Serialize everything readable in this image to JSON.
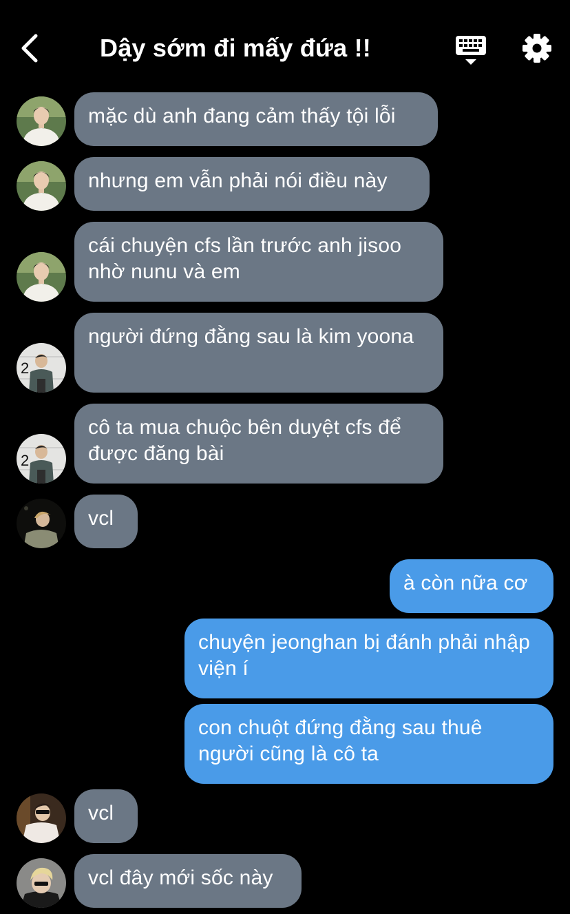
{
  "header": {
    "title": "Dậy sớm đi mấy đứa !!",
    "back_icon": "chevron-left-icon",
    "keyboard_icon": "keyboard-icon",
    "settings_icon": "gear-icon"
  },
  "colors": {
    "incoming_bubble": "#6b7785",
    "outgoing_bubble": "#4a9be8",
    "background": "#000000"
  },
  "messages": [
    {
      "direction": "incoming",
      "avatar": "avatar-white-shirt",
      "text": "mặc dù anh đang cảm thấy tội lỗi"
    },
    {
      "direction": "incoming",
      "avatar": "avatar-white-shirt",
      "text": "nhưng em vẫn phải nói điều này"
    },
    {
      "direction": "incoming",
      "avatar": "avatar-white-shirt",
      "text": "cái chuyện cfs lần trước anh jisoo nhờ nunu và em"
    },
    {
      "direction": "incoming",
      "avatar": "avatar-mugshot",
      "text": "người đứng đằng sau là kim yoona"
    },
    {
      "direction": "incoming",
      "avatar": "avatar-mugshot",
      "text": "cô ta mua chuộc bên duyệt cfs để được đăng bài"
    },
    {
      "direction": "incoming",
      "avatar": "avatar-green-shirt",
      "text": "vcl"
    },
    {
      "direction": "outgoing",
      "text": "à còn nữa cơ"
    },
    {
      "direction": "outgoing",
      "text": "chuyện jeonghan bị đánh phải nhập viện í"
    },
    {
      "direction": "outgoing",
      "text": "con chuột đứng đằng sau thuê người cũng là cô ta"
    },
    {
      "direction": "incoming",
      "avatar": "avatar-sunglasses",
      "text": "vcl"
    },
    {
      "direction": "incoming",
      "avatar": "avatar-blond",
      "text": "vcl đây mới sốc này"
    }
  ]
}
